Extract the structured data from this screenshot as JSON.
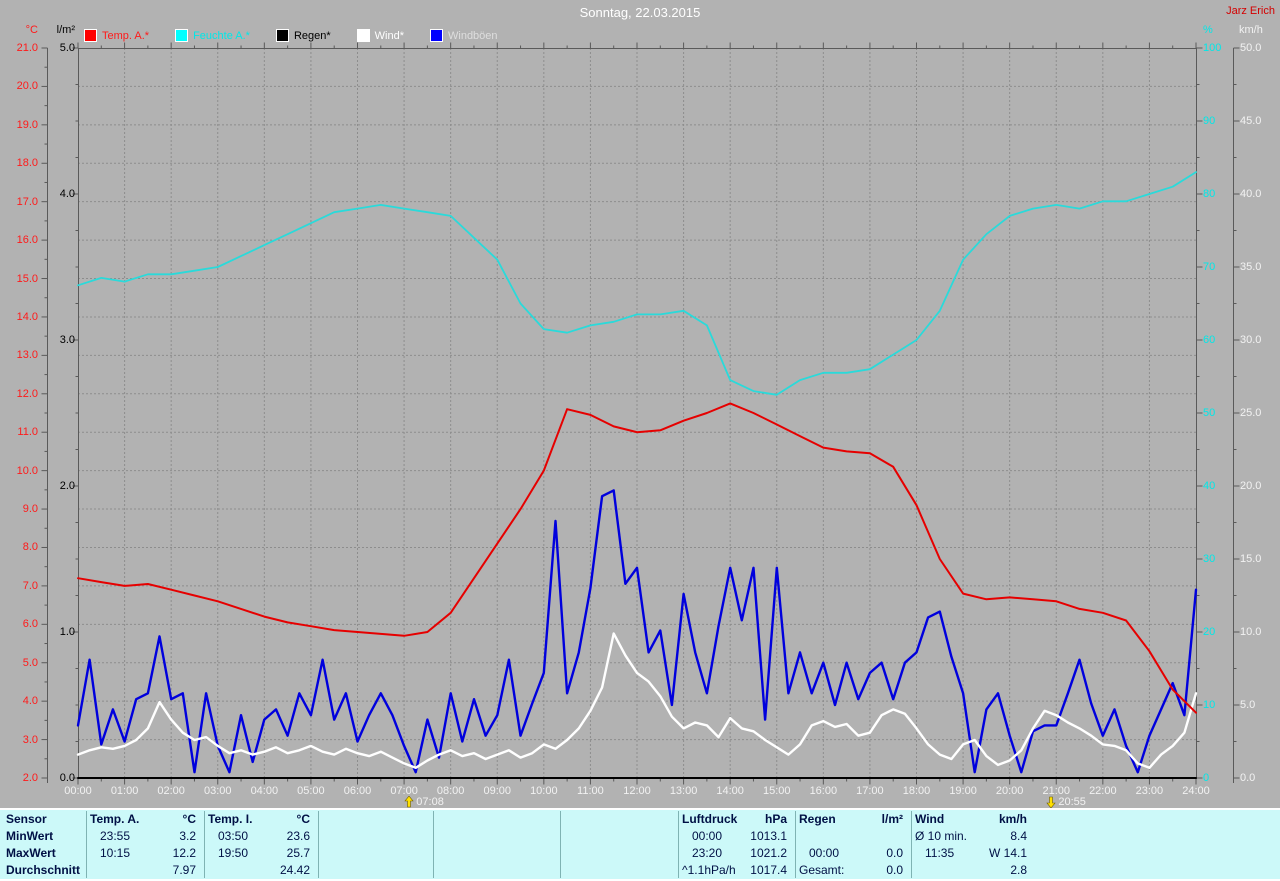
{
  "header": {
    "title": "Sonntag, 22.03.2015",
    "user": "Jarz Erich"
  },
  "legend": [
    {
      "label": "Temp. A.*",
      "swatch_color": "#ff0000",
      "text_color": "#ff1a1a"
    },
    {
      "label": "Feuchte A.*",
      "swatch_color": "#00ffff",
      "text_color": "#00e8e8"
    },
    {
      "label": "Regen*",
      "swatch_color": "#000000",
      "text_color": "#000000"
    },
    {
      "label": "Wind*",
      "swatch_color": "#ffffff",
      "text_color": "#ffffff"
    },
    {
      "label": "Windböen",
      "swatch_color": "#0000ff",
      "text_color": "#dedede"
    }
  ],
  "axes": {
    "temp": {
      "unit": "°C",
      "color": "#ff1a1a",
      "min": 2,
      "max": 21,
      "labels": [
        "21.0",
        "20.0",
        "19.0",
        "18.0",
        "17.0",
        "16.0",
        "15.0",
        "14.0",
        "13.0",
        "12.0",
        "11.0",
        "10.0",
        "9.0",
        "8.0",
        "7.0",
        "6.0",
        "5.0",
        "4.0",
        "3.0",
        "2.0"
      ]
    },
    "rain": {
      "unit": "l/m²",
      "color": "#000000",
      "min": 0,
      "max": 5,
      "labels": [
        "5.0",
        "4.0",
        "3.0",
        "2.0",
        "1.0",
        "0.0"
      ]
    },
    "hum": {
      "unit": "%",
      "color": "#00e8e8",
      "min": 0,
      "max": 100,
      "labels": [
        "100",
        "90",
        "80",
        "70",
        "60",
        "50",
        "40",
        "30",
        "20",
        "10",
        "0"
      ]
    },
    "wind": {
      "unit": "km/h",
      "color": "#f2f2f2",
      "min": 0,
      "max": 50,
      "labels": [
        "50.0",
        "45.0",
        "40.0",
        "35.0",
        "30.0",
        "25.0",
        "20.0",
        "15.0",
        "10.0",
        "5.0",
        "0.0"
      ]
    },
    "x": {
      "labels": [
        "00:00",
        "01:00",
        "02:00",
        "03:00",
        "04:00",
        "05:00",
        "06:00",
        "07:00",
        "08:00",
        "09:00",
        "10:00",
        "11:00",
        "12:00",
        "13:00",
        "14:00",
        "15:00",
        "16:00",
        "17:00",
        "18:00",
        "19:00",
        "20:00",
        "21:00",
        "22:00",
        "23:00",
        "24:00"
      ]
    }
  },
  "sun_markers": [
    {
      "type": "sunrise",
      "time": "07:08"
    },
    {
      "type": "sunset",
      "time": "20:55"
    }
  ],
  "chart_data": {
    "type": "line",
    "title": "Sonntag, 22.03.2015",
    "x_range_minutes": [
      0,
      1440
    ],
    "grid": "dashed, 1 h vertical / 1 °C horizontal",
    "series": [
      {
        "name": "Regen",
        "axis": "rain",
        "color": "#000000",
        "width": 2,
        "step_min": 720,
        "values": [
          0,
          0,
          0
        ]
      },
      {
        "name": "Windböen",
        "axis": "wind",
        "color": "#0000dd",
        "width": 2.4,
        "step_min": 15,
        "values": [
          3.6,
          8.1,
          2.3,
          4.7,
          2.5,
          5.4,
          5.8,
          9.7,
          5.4,
          5.8,
          0.4,
          5.8,
          2.2,
          0.4,
          4.3,
          1.1,
          4.0,
          4.7,
          2.9,
          5.8,
          4.3,
          8.1,
          4.0,
          5.8,
          2.5,
          4.3,
          5.8,
          4.3,
          2.2,
          0.4,
          4.0,
          1.4,
          5.8,
          2.5,
          5.4,
          2.9,
          4.3,
          8.1,
          2.9,
          5.1,
          7.2,
          17.6,
          5.8,
          8.6,
          13.0,
          19.3,
          19.7,
          13.3,
          14.4,
          8.6,
          10.1,
          5.0,
          12.6,
          8.6,
          5.8,
          10.4,
          14.4,
          10.8,
          14.4,
          4.0,
          14.4,
          5.8,
          8.6,
          5.8,
          7.9,
          5.0,
          7.9,
          5.4,
          7.2,
          7.9,
          5.4,
          7.9,
          8.6,
          11.0,
          11.4,
          8.3,
          5.8,
          0.4,
          4.7,
          5.8,
          2.9,
          0.4,
          3.2,
          3.6,
          3.6,
          5.8,
          8.1,
          5.1,
          2.9,
          4.7,
          2.2,
          0.4,
          2.9,
          4.7,
          6.5,
          4.3,
          12.9
        ]
      },
      {
        "name": "Wind",
        "axis": "wind",
        "color": "#ffffff",
        "width": 2.4,
        "step_min": 15,
        "values": [
          1.6,
          1.9,
          2.1,
          2.0,
          2.2,
          2.6,
          3.4,
          5.2,
          4.0,
          3.1,
          2.6,
          2.8,
          2.2,
          1.7,
          1.9,
          1.6,
          1.8,
          2.1,
          1.7,
          1.9,
          2.2,
          1.8,
          1.6,
          2.0,
          1.7,
          1.5,
          1.8,
          1.4,
          1.0,
          0.7,
          1.2,
          1.6,
          1.9,
          1.5,
          1.7,
          1.3,
          1.6,
          1.9,
          1.4,
          1.7,
          2.3,
          2.0,
          2.6,
          3.4,
          4.6,
          6.2,
          9.9,
          8.4,
          7.2,
          6.6,
          5.6,
          4.2,
          3.4,
          3.8,
          3.6,
          2.8,
          4.1,
          3.4,
          3.2,
          2.6,
          2.1,
          1.6,
          2.3,
          3.6,
          3.9,
          3.5,
          3.7,
          2.9,
          3.1,
          4.3,
          4.7,
          4.4,
          3.4,
          2.3,
          1.6,
          1.3,
          2.3,
          2.6,
          1.5,
          0.9,
          1.2,
          1.9,
          3.4,
          4.6,
          4.3,
          3.8,
          3.4,
          2.9,
          2.3,
          2.2,
          1.9,
          1.0,
          0.7,
          1.6,
          2.2,
          3.1,
          5.8
        ]
      },
      {
        "name": "Feuchte A.",
        "axis": "hum",
        "color": "#2adada",
        "width": 1.8,
        "step_min": 30,
        "values": [
          67.5,
          68.5,
          68,
          69,
          69,
          69.5,
          70,
          71.5,
          73,
          74.5,
          76,
          77.5,
          78,
          78.5,
          78,
          77.5,
          77,
          74,
          71,
          65,
          61.5,
          61,
          62,
          62.5,
          63.5,
          63.5,
          64,
          62,
          54.5,
          53,
          52.5,
          54.5,
          55.5,
          55.5,
          56,
          58,
          60,
          64,
          71,
          74.5,
          77,
          78,
          78.5,
          78,
          79,
          79,
          80,
          81,
          83
        ]
      },
      {
        "name": "Temp. A.",
        "axis": "temp",
        "color": "#e60000",
        "width": 2,
        "step_min": 30,
        "values": [
          7.2,
          7.1,
          7.0,
          7.05,
          6.9,
          6.75,
          6.6,
          6.4,
          6.2,
          6.05,
          5.95,
          5.85,
          5.8,
          5.75,
          5.7,
          5.8,
          6.3,
          7.2,
          8.1,
          9.0,
          10.0,
          11.6,
          11.45,
          11.15,
          11.0,
          11.05,
          11.3,
          11.5,
          11.75,
          11.5,
          11.2,
          10.9,
          10.6,
          10.5,
          10.45,
          10.1,
          9.1,
          7.7,
          6.8,
          6.65,
          6.7,
          6.65,
          6.6,
          6.4,
          6.3,
          6.1,
          5.3,
          4.3,
          3.7
        ]
      }
    ]
  },
  "table": {
    "row_labels": [
      "Sensor",
      "MinWert",
      "MaxWert",
      "Durchschnitt"
    ],
    "columns": [
      {
        "name": "Temp. A.",
        "unit": "°C",
        "rows": [
          [
            "23:55",
            "3.2"
          ],
          [
            "10:15",
            "12.2"
          ],
          [
            "",
            "7.97"
          ]
        ]
      },
      {
        "name": "Temp. I.",
        "unit": "°C",
        "rows": [
          [
            "03:50",
            "23.6"
          ],
          [
            "19:50",
            "25.7"
          ],
          [
            "",
            "24.42"
          ]
        ]
      },
      {
        "name": "",
        "unit": "",
        "rows": [
          [
            "",
            ""
          ],
          [
            "",
            ""
          ],
          [
            "",
            ""
          ]
        ]
      },
      {
        "name": "",
        "unit": "",
        "rows": [
          [
            "",
            ""
          ],
          [
            "",
            ""
          ],
          [
            "",
            ""
          ]
        ]
      },
      {
        "name": "",
        "unit": "",
        "rows": [
          [
            "",
            ""
          ],
          [
            "",
            ""
          ],
          [
            "",
            ""
          ]
        ]
      },
      {
        "name": "Luftdruck",
        "unit": "hPa",
        "rows": [
          [
            "00:00",
            "1013.1"
          ],
          [
            "23:20",
            "1021.2"
          ],
          [
            "^1.1hPa/h",
            "1017.4"
          ]
        ]
      },
      {
        "name": "Regen",
        "unit": "l/m²",
        "rows": [
          [
            "",
            ""
          ],
          [
            "00:00",
            "0.0"
          ],
          [
            "Gesamt:",
            "0.0"
          ]
        ]
      },
      {
        "name": "Wind",
        "unit": "km/h",
        "rows": [
          [
            "Ø 10 min.",
            "8.4"
          ],
          [
            "11:35",
            "W 14.1"
          ],
          [
            "",
            "2.8"
          ]
        ]
      }
    ]
  }
}
